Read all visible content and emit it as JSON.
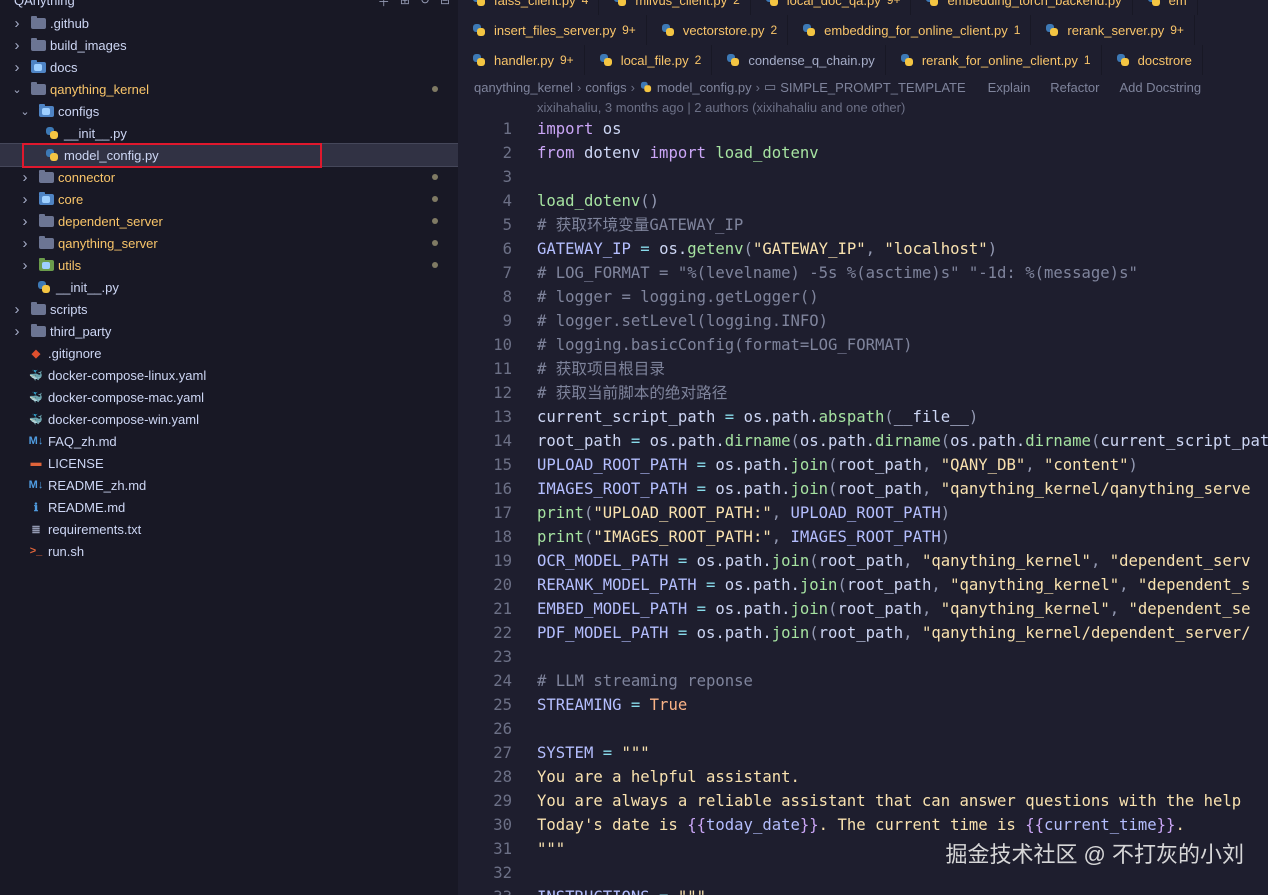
{
  "explorer": {
    "root_title": "QAnything",
    "actions": [
      "new-file",
      "new-folder",
      "refresh",
      "collapse"
    ],
    "items": [
      {
        "label": ".github",
        "kind": "folder",
        "color": "gray",
        "depth": 0,
        "open": false,
        "modified": false,
        "icon": "github-folder-icon"
      },
      {
        "label": "build_images",
        "kind": "folder",
        "color": "gray",
        "depth": 0,
        "open": false,
        "modified": false,
        "icon": "folder-icon"
      },
      {
        "label": "docs",
        "kind": "folder",
        "color": "blue",
        "depth": 0,
        "open": false,
        "modified": false,
        "icon": "docs-folder-icon"
      },
      {
        "label": "qanything_kernel",
        "kind": "folder",
        "color": "gray",
        "depth": 0,
        "open": true,
        "modified": true,
        "icon": "folder-icon"
      },
      {
        "label": "configs",
        "kind": "folder",
        "color": "blue",
        "depth": 1,
        "open": true,
        "modified": false,
        "icon": "config-folder-icon"
      },
      {
        "label": "__init__.py",
        "kind": "py",
        "depth": 2,
        "modified": false,
        "icon": "python-file-icon"
      },
      {
        "label": "model_config.py",
        "kind": "py",
        "depth": 2,
        "modified": false,
        "selected": true,
        "icon": "python-file-icon"
      },
      {
        "label": "connector",
        "kind": "folder",
        "color": "gray",
        "depth": 1,
        "open": false,
        "modified": true,
        "icon": "folder-icon"
      },
      {
        "label": "core",
        "kind": "folder",
        "color": "blue",
        "depth": 1,
        "open": false,
        "modified": true,
        "icon": "core-folder-icon"
      },
      {
        "label": "dependent_server",
        "kind": "folder",
        "color": "gray",
        "depth": 1,
        "open": false,
        "modified": true,
        "icon": "folder-icon"
      },
      {
        "label": "qanything_server",
        "kind": "folder",
        "color": "gray",
        "depth": 1,
        "open": false,
        "modified": true,
        "icon": "folder-icon"
      },
      {
        "label": "utils",
        "kind": "folder",
        "color": "green",
        "depth": 1,
        "open": false,
        "modified": true,
        "icon": "utils-folder-icon"
      },
      {
        "label": "__init__.py",
        "kind": "py",
        "depth": 1,
        "modified": false,
        "icon": "python-file-icon"
      },
      {
        "label": "scripts",
        "kind": "folder",
        "color": "gray",
        "depth": 0,
        "open": false,
        "modified": false,
        "icon": "folder-icon"
      },
      {
        "label": "third_party",
        "kind": "folder",
        "color": "gray",
        "depth": 0,
        "open": false,
        "modified": false,
        "icon": "folder-icon"
      },
      {
        "label": ".gitignore",
        "kind": "file",
        "glyph": "◆",
        "glyph_color": "#e0502e",
        "depth": 0,
        "icon": "git-icon"
      },
      {
        "label": "docker-compose-linux.yaml",
        "kind": "file",
        "glyph": "🐳",
        "glyph_color": "#3a8fd8",
        "depth": 0,
        "icon": "docker-icon"
      },
      {
        "label": "docker-compose-mac.yaml",
        "kind": "file",
        "glyph": "🐳",
        "glyph_color": "#3a8fd8",
        "depth": 0,
        "icon": "docker-icon"
      },
      {
        "label": "docker-compose-win.yaml",
        "kind": "file",
        "glyph": "🐳",
        "glyph_color": "#3a8fd8",
        "depth": 0,
        "icon": "docker-icon"
      },
      {
        "label": "FAQ_zh.md",
        "kind": "file",
        "glyph": "M↓",
        "glyph_color": "#4f9be0",
        "depth": 0,
        "icon": "markdown-icon"
      },
      {
        "label": "LICENSE",
        "kind": "file",
        "glyph": "▬",
        "glyph_color": "#e0643a",
        "depth": 0,
        "icon": "license-icon"
      },
      {
        "label": "README_zh.md",
        "kind": "file",
        "glyph": "M↓",
        "glyph_color": "#4f9be0",
        "depth": 0,
        "icon": "markdown-icon"
      },
      {
        "label": "README.md",
        "kind": "file",
        "glyph": "ℹ",
        "glyph_color": "#4f9be0",
        "depth": 0,
        "icon": "info-icon"
      },
      {
        "label": "requirements.txt",
        "kind": "file",
        "glyph": "≣",
        "glyph_color": "#9399b2",
        "depth": 0,
        "icon": "text-file-icon"
      },
      {
        "label": "run.sh",
        "kind": "file",
        "glyph": ">_",
        "glyph_color": "#e0643a",
        "depth": 0,
        "icon": "shell-icon"
      }
    ]
  },
  "tabs": {
    "row1": [
      {
        "label": "faiss_client.py",
        "count": "4"
      },
      {
        "label": "milvus_client.py",
        "count": "2"
      },
      {
        "label": "local_doc_qa.py",
        "count": "9+"
      },
      {
        "label": "embedding_torch_backend.py",
        "count": ""
      },
      {
        "label": "em",
        "count": ""
      }
    ],
    "row2": [
      {
        "label": "insert_files_server.py",
        "count": "9+"
      },
      {
        "label": "vectorstore.py",
        "count": "2"
      },
      {
        "label": "embedding_for_online_client.py",
        "count": "1"
      },
      {
        "label": "rerank_server.py",
        "count": "9+"
      }
    ],
    "row3": [
      {
        "label": "handler.py",
        "count": "9+",
        "plain": false
      },
      {
        "label": "local_file.py",
        "count": "2",
        "plain": false
      },
      {
        "label": "condense_q_chain.py",
        "count": "",
        "plain": true
      },
      {
        "label": "rerank_for_online_client.py",
        "count": "1",
        "plain": false
      },
      {
        "label": "docstrore",
        "count": "",
        "plain": false
      }
    ]
  },
  "breadcrumbs": {
    "parts": [
      "qanything_kernel",
      "configs",
      "model_config.py",
      "SIMPLE_PROMPT_TEMPLATE"
    ],
    "lenses": [
      "Explain",
      "Refactor",
      "Add Docstring"
    ]
  },
  "blame": "xixihahaliu, 3 months ago | 2 authors (xixihahaliu and one other)",
  "code": {
    "lines": [
      {
        "n": "1",
        "toks": [
          [
            "kw",
            "import"
          ],
          [
            "tx",
            " os"
          ]
        ]
      },
      {
        "n": "2",
        "toks": [
          [
            "kw",
            "from"
          ],
          [
            "tx",
            " dotenv "
          ],
          [
            "kw",
            "import"
          ],
          [
            "tx",
            " "
          ],
          [
            "fn",
            "load_dotenv"
          ]
        ]
      },
      {
        "n": "3",
        "toks": []
      },
      {
        "n": "4",
        "toks": [
          [
            "fn",
            "load_dotenv"
          ],
          [
            "pu",
            "()"
          ]
        ]
      },
      {
        "n": "5",
        "toks": [
          [
            "cm",
            "# 获取环境变量GATEWAY_IP"
          ]
        ]
      },
      {
        "n": "6",
        "toks": [
          [
            "var",
            "GATEWAY_IP"
          ],
          [
            "op",
            " = "
          ],
          [
            "tx",
            "os."
          ],
          [
            "fn",
            "getenv"
          ],
          [
            "pu",
            "("
          ],
          [
            "str",
            "\"GATEWAY_IP\""
          ],
          [
            "pu",
            ", "
          ],
          [
            "str",
            "\"localhost\""
          ],
          [
            "pu",
            ")"
          ]
        ]
      },
      {
        "n": "7",
        "toks": [
          [
            "cm",
            "# LOG_FORMAT = \"%(levelname) -5s %(asctime)s\" \"-1d: %(message)s\""
          ]
        ]
      },
      {
        "n": "8",
        "toks": [
          [
            "cm",
            "# logger = logging.getLogger()"
          ]
        ]
      },
      {
        "n": "9",
        "toks": [
          [
            "cm",
            "# logger.setLevel(logging.INFO)"
          ]
        ]
      },
      {
        "n": "10",
        "toks": [
          [
            "cm",
            "# logging.basicConfig(format=LOG_FORMAT)"
          ]
        ]
      },
      {
        "n": "11",
        "toks": [
          [
            "cm",
            "# 获取项目根目录"
          ]
        ]
      },
      {
        "n": "12",
        "toks": [
          [
            "cm",
            "# 获取当前脚本的绝对路径"
          ]
        ]
      },
      {
        "n": "13",
        "toks": [
          [
            "tx",
            "current_script_path"
          ],
          [
            "op",
            " = "
          ],
          [
            "tx",
            "os.path."
          ],
          [
            "fn",
            "abspath"
          ],
          [
            "pu",
            "("
          ],
          [
            "tx",
            "__file__"
          ],
          [
            "pu",
            ")"
          ]
        ]
      },
      {
        "n": "14",
        "toks": [
          [
            "tx",
            "root_path"
          ],
          [
            "op",
            " = "
          ],
          [
            "tx",
            "os.path."
          ],
          [
            "fn",
            "dirname"
          ],
          [
            "pu",
            "("
          ],
          [
            "tx",
            "os.path."
          ],
          [
            "fn",
            "dirname"
          ],
          [
            "pu",
            "("
          ],
          [
            "tx",
            "os.path."
          ],
          [
            "fn",
            "dirname"
          ],
          [
            "pu",
            "("
          ],
          [
            "tx",
            "current_script_path"
          ]
        ]
      },
      {
        "n": "15",
        "toks": [
          [
            "var",
            "UPLOAD_ROOT_PATH"
          ],
          [
            "op",
            " = "
          ],
          [
            "tx",
            "os.path."
          ],
          [
            "fn",
            "join"
          ],
          [
            "pu",
            "("
          ],
          [
            "tx",
            "root_path"
          ],
          [
            "pu",
            ", "
          ],
          [
            "str",
            "\"QANY_DB\""
          ],
          [
            "pu",
            ", "
          ],
          [
            "str",
            "\"content\""
          ],
          [
            "pu",
            ")"
          ]
        ]
      },
      {
        "n": "16",
        "toks": [
          [
            "var",
            "IMAGES_ROOT_PATH"
          ],
          [
            "op",
            " = "
          ],
          [
            "tx",
            "os.path."
          ],
          [
            "fn",
            "join"
          ],
          [
            "pu",
            "("
          ],
          [
            "tx",
            "root_path"
          ],
          [
            "pu",
            ", "
          ],
          [
            "str",
            "\"qanything_kernel/qanything_serve"
          ]
        ]
      },
      {
        "n": "17",
        "toks": [
          [
            "fn",
            "print"
          ],
          [
            "pu",
            "("
          ],
          [
            "str",
            "\"UPLOAD_ROOT_PATH:\""
          ],
          [
            "pu",
            ", "
          ],
          [
            "var",
            "UPLOAD_ROOT_PATH"
          ],
          [
            "pu",
            ")"
          ]
        ]
      },
      {
        "n": "18",
        "toks": [
          [
            "fn",
            "print"
          ],
          [
            "pu",
            "("
          ],
          [
            "str",
            "\"IMAGES_ROOT_PATH:\""
          ],
          [
            "pu",
            ", "
          ],
          [
            "var",
            "IMAGES_ROOT_PATH"
          ],
          [
            "pu",
            ")"
          ]
        ]
      },
      {
        "n": "19",
        "toks": [
          [
            "var",
            "OCR_MODEL_PATH"
          ],
          [
            "op",
            " = "
          ],
          [
            "tx",
            "os.path."
          ],
          [
            "fn",
            "join"
          ],
          [
            "pu",
            "("
          ],
          [
            "tx",
            "root_path"
          ],
          [
            "pu",
            ", "
          ],
          [
            "str",
            "\"qanything_kernel\""
          ],
          [
            "pu",
            ", "
          ],
          [
            "str",
            "\"dependent_serv"
          ]
        ]
      },
      {
        "n": "20",
        "toks": [
          [
            "var",
            "RERANK_MODEL_PATH"
          ],
          [
            "op",
            " = "
          ],
          [
            "tx",
            "os.path."
          ],
          [
            "fn",
            "join"
          ],
          [
            "pu",
            "("
          ],
          [
            "tx",
            "root_path"
          ],
          [
            "pu",
            ", "
          ],
          [
            "str",
            "\"qanything_kernel\""
          ],
          [
            "pu",
            ", "
          ],
          [
            "str",
            "\"dependent_s"
          ]
        ]
      },
      {
        "n": "21",
        "toks": [
          [
            "var",
            "EMBED_MODEL_PATH"
          ],
          [
            "op",
            " = "
          ],
          [
            "tx",
            "os.path."
          ],
          [
            "fn",
            "join"
          ],
          [
            "pu",
            "("
          ],
          [
            "tx",
            "root_path"
          ],
          [
            "pu",
            ", "
          ],
          [
            "str",
            "\"qanything_kernel\""
          ],
          [
            "pu",
            ", "
          ],
          [
            "str",
            "\"dependent_se"
          ]
        ]
      },
      {
        "n": "22",
        "toks": [
          [
            "var",
            "PDF_MODEL_PATH"
          ],
          [
            "op",
            " = "
          ],
          [
            "tx",
            "os.path."
          ],
          [
            "fn",
            "join"
          ],
          [
            "pu",
            "("
          ],
          [
            "tx",
            "root_path"
          ],
          [
            "pu",
            ", "
          ],
          [
            "str",
            "\"qanything_kernel/dependent_server/"
          ]
        ]
      },
      {
        "n": "23",
        "toks": []
      },
      {
        "n": "24",
        "toks": [
          [
            "cm",
            "# LLM streaming reponse"
          ]
        ]
      },
      {
        "n": "25",
        "toks": [
          [
            "var",
            "STREAMING"
          ],
          [
            "op",
            " = "
          ],
          [
            "bi",
            "True"
          ]
        ]
      },
      {
        "n": "26",
        "toks": []
      },
      {
        "n": "27",
        "toks": [
          [
            "var",
            "SYSTEM"
          ],
          [
            "op",
            " = "
          ],
          [
            "str",
            "\"\"\""
          ]
        ]
      },
      {
        "n": "28",
        "toks": [
          [
            "str",
            "You are a helpful assistant."
          ]
        ]
      },
      {
        "n": "29",
        "toks": [
          [
            "str",
            "You are always a reliable assistant that can answer questions with the help"
          ]
        ]
      },
      {
        "n": "30",
        "toks": [
          [
            "str",
            "Today's date is "
          ],
          [
            "kw",
            "{{"
          ],
          [
            "var",
            "today_date"
          ],
          [
            "kw",
            "}}"
          ],
          [
            "str",
            ". The current time is "
          ],
          [
            "kw",
            "{{"
          ],
          [
            "var",
            "current_time"
          ],
          [
            "kw",
            "}}"
          ],
          [
            "str",
            "."
          ]
        ]
      },
      {
        "n": "31",
        "toks": [
          [
            "str",
            "\"\"\""
          ]
        ]
      },
      {
        "n": "32",
        "toks": []
      },
      {
        "n": "33",
        "toks": [
          [
            "var",
            "INSTRUCTIONS"
          ],
          [
            "op",
            " = "
          ],
          [
            "str",
            "\"\"\""
          ]
        ]
      }
    ]
  },
  "watermark": "掘金技术社区 @ 不打灰的小刘",
  "colors": {
    "selection_outline": "#e0182d",
    "modified_text": "#f9c56a"
  }
}
